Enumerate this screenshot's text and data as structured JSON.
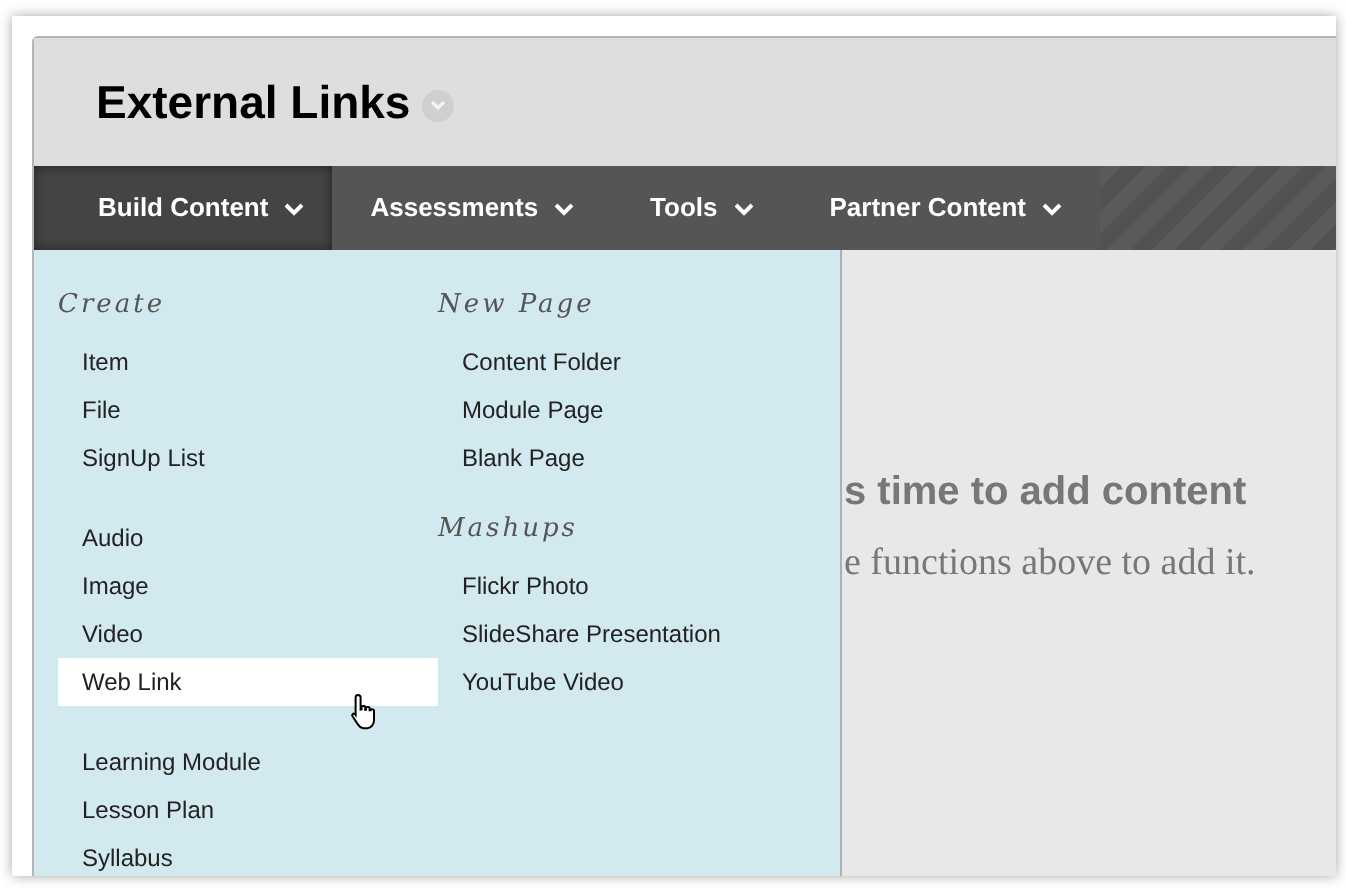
{
  "page": {
    "title": "External Links"
  },
  "nav": [
    {
      "label": "Build Content",
      "selected": true
    },
    {
      "label": "Assessments",
      "selected": false
    },
    {
      "label": "Tools",
      "selected": false
    },
    {
      "label": "Partner Content",
      "selected": false
    }
  ],
  "menu": {
    "columns": [
      {
        "sections": [
          {
            "heading": "Create",
            "items": [
              {
                "label": "Item",
                "selected": false
              },
              {
                "label": "File",
                "selected": false
              },
              {
                "label": "SignUp List",
                "selected": false
              }
            ]
          },
          {
            "items": [
              {
                "label": "Audio",
                "selected": false
              },
              {
                "label": "Image",
                "selected": false
              },
              {
                "label": "Video",
                "selected": false
              },
              {
                "label": "Web Link",
                "selected": true
              }
            ]
          },
          {
            "items": [
              {
                "label": "Learning Module",
                "selected": false
              },
              {
                "label": "Lesson Plan",
                "selected": false
              },
              {
                "label": "Syllabus",
                "selected": false
              }
            ]
          }
        ]
      },
      {
        "sections": [
          {
            "heading": "New Page",
            "items": [
              {
                "label": "Content Folder",
                "selected": false
              },
              {
                "label": "Module Page",
                "selected": false
              },
              {
                "label": "Blank Page",
                "selected": false
              }
            ]
          },
          {
            "heading": "Mashups",
            "items": [
              {
                "label": "Flickr Photo",
                "selected": false
              },
              {
                "label": "SlideShare Presentation",
                "selected": false
              },
              {
                "label": "YouTube Video",
                "selected": false
              }
            ]
          }
        ]
      }
    ]
  },
  "empty_state": {
    "heading": "s time to add content",
    "text": "e functions above to add it."
  }
}
